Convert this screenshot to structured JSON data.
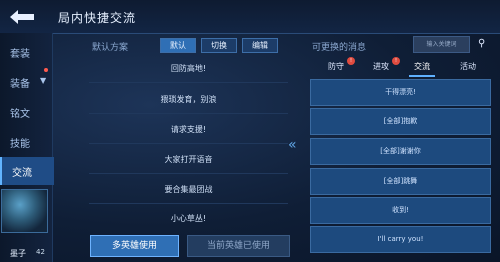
{
  "header": {
    "title": "局内快捷交流"
  },
  "sidebar": {
    "items": [
      {
        "label": "套装"
      },
      {
        "label": "装备"
      },
      {
        "label": "铭文"
      },
      {
        "label": "技能"
      },
      {
        "label": "交流"
      }
    ],
    "active": "交流",
    "player": {
      "name": "墨子",
      "level": "42"
    }
  },
  "left": {
    "label": "默认方案",
    "buttons": {
      "default": "默认",
      "switch": "切换",
      "edit": "编辑"
    },
    "messages": [
      "回防高地!",
      "猥琐发育，别浪",
      "请求支援!",
      "大家打开语音",
      "要合集最团战",
      "小心草丛!"
    ],
    "bottom": {
      "multi": "多英雄使用",
      "current": "当前英雄已使用"
    }
  },
  "right": {
    "label": "可更换的消息",
    "search_placeholder": "输入关键词",
    "tabs": [
      {
        "label": "防守",
        "badge": "!"
      },
      {
        "label": "进攻",
        "badge": "!"
      },
      {
        "label": "交流"
      },
      {
        "label": "活动"
      }
    ],
    "active_tab": "交流",
    "options": [
      "干得漂亮!",
      "[全部]抱歉",
      "[全部]谢谢你",
      "[全部]跳舞",
      "收到!",
      "I'll carry you!"
    ]
  },
  "colors": {
    "accent": "#5fb1ff",
    "button_active": "#2f6fb5",
    "panel": "#1d4a7e"
  }
}
